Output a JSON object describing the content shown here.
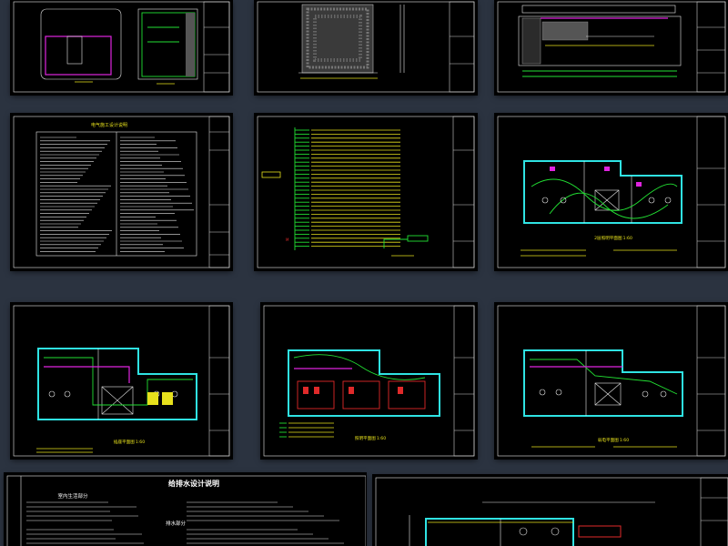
{
  "sheets": {
    "electrical_notes": {
      "title": "电气施工设计说明"
    },
    "plan_1": {
      "caption": "2层照明平面图",
      "scale": "1:60"
    },
    "plan_2": {
      "caption": "插座平面图",
      "scale": "1:60"
    },
    "plan_3": {
      "caption": "照明平面图",
      "scale": "1:60"
    },
    "plan_4": {
      "caption": "弱电平面图",
      "scale": "1:60"
    },
    "water_notes": {
      "title": "给排水设计说明",
      "subtitle": "室内生活部分",
      "section_2": "排水部分"
    }
  },
  "colors": {
    "page_bg": "#2b3340",
    "sheet_bg": "#000000",
    "wall": "#2fe3e3",
    "wire": "#22e033",
    "accent": "#e024e0",
    "text": "#e6e01c"
  }
}
